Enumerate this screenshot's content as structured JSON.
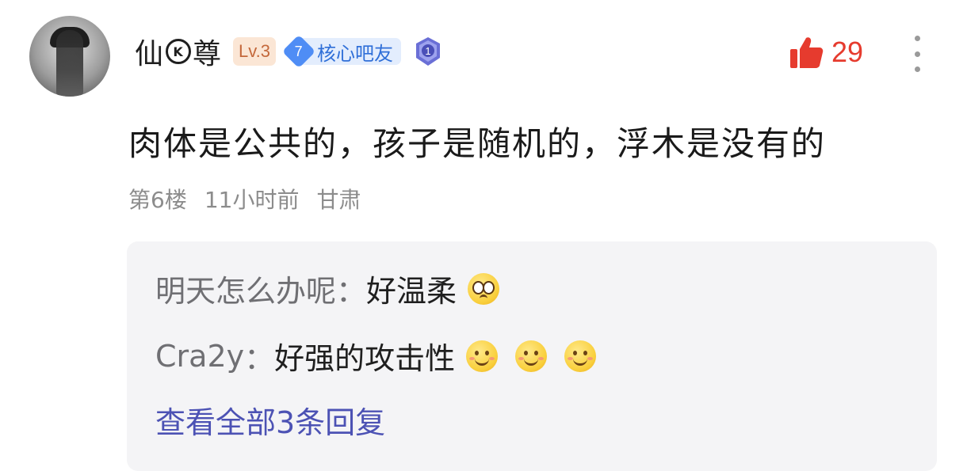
{
  "post": {
    "username_pre": "仙",
    "username_mid_icon": "sk-logo-icon",
    "username_post": "尊",
    "level_badge": "Lv.3",
    "fan_level": "7",
    "fan_label": "核心吧友",
    "medal_number": "1",
    "like_count": "29",
    "content": "肉体是公共的，孩子是随机的，浮木是没有的",
    "floor": "第6楼",
    "time": "11小时前",
    "location": "甘肃"
  },
  "replies": [
    {
      "author": "明天怎么办呢",
      "sep": "：",
      "text": "好温柔",
      "emoji_count": 1,
      "emoji_kind": "pleading-face-icon"
    },
    {
      "author": "Cra2y",
      "sep": "：",
      "text": "好强的攻击性",
      "emoji_count": 3,
      "emoji_kind": "smile-face-icon"
    }
  ],
  "view_all_label": "查看全部3条回复",
  "colors": {
    "like": "#e63b2e",
    "link": "#4c52b4",
    "fan_badge": "#4f8df5",
    "level_badge_bg": "#fbe6d5",
    "reply_bg": "#f4f4f6"
  }
}
